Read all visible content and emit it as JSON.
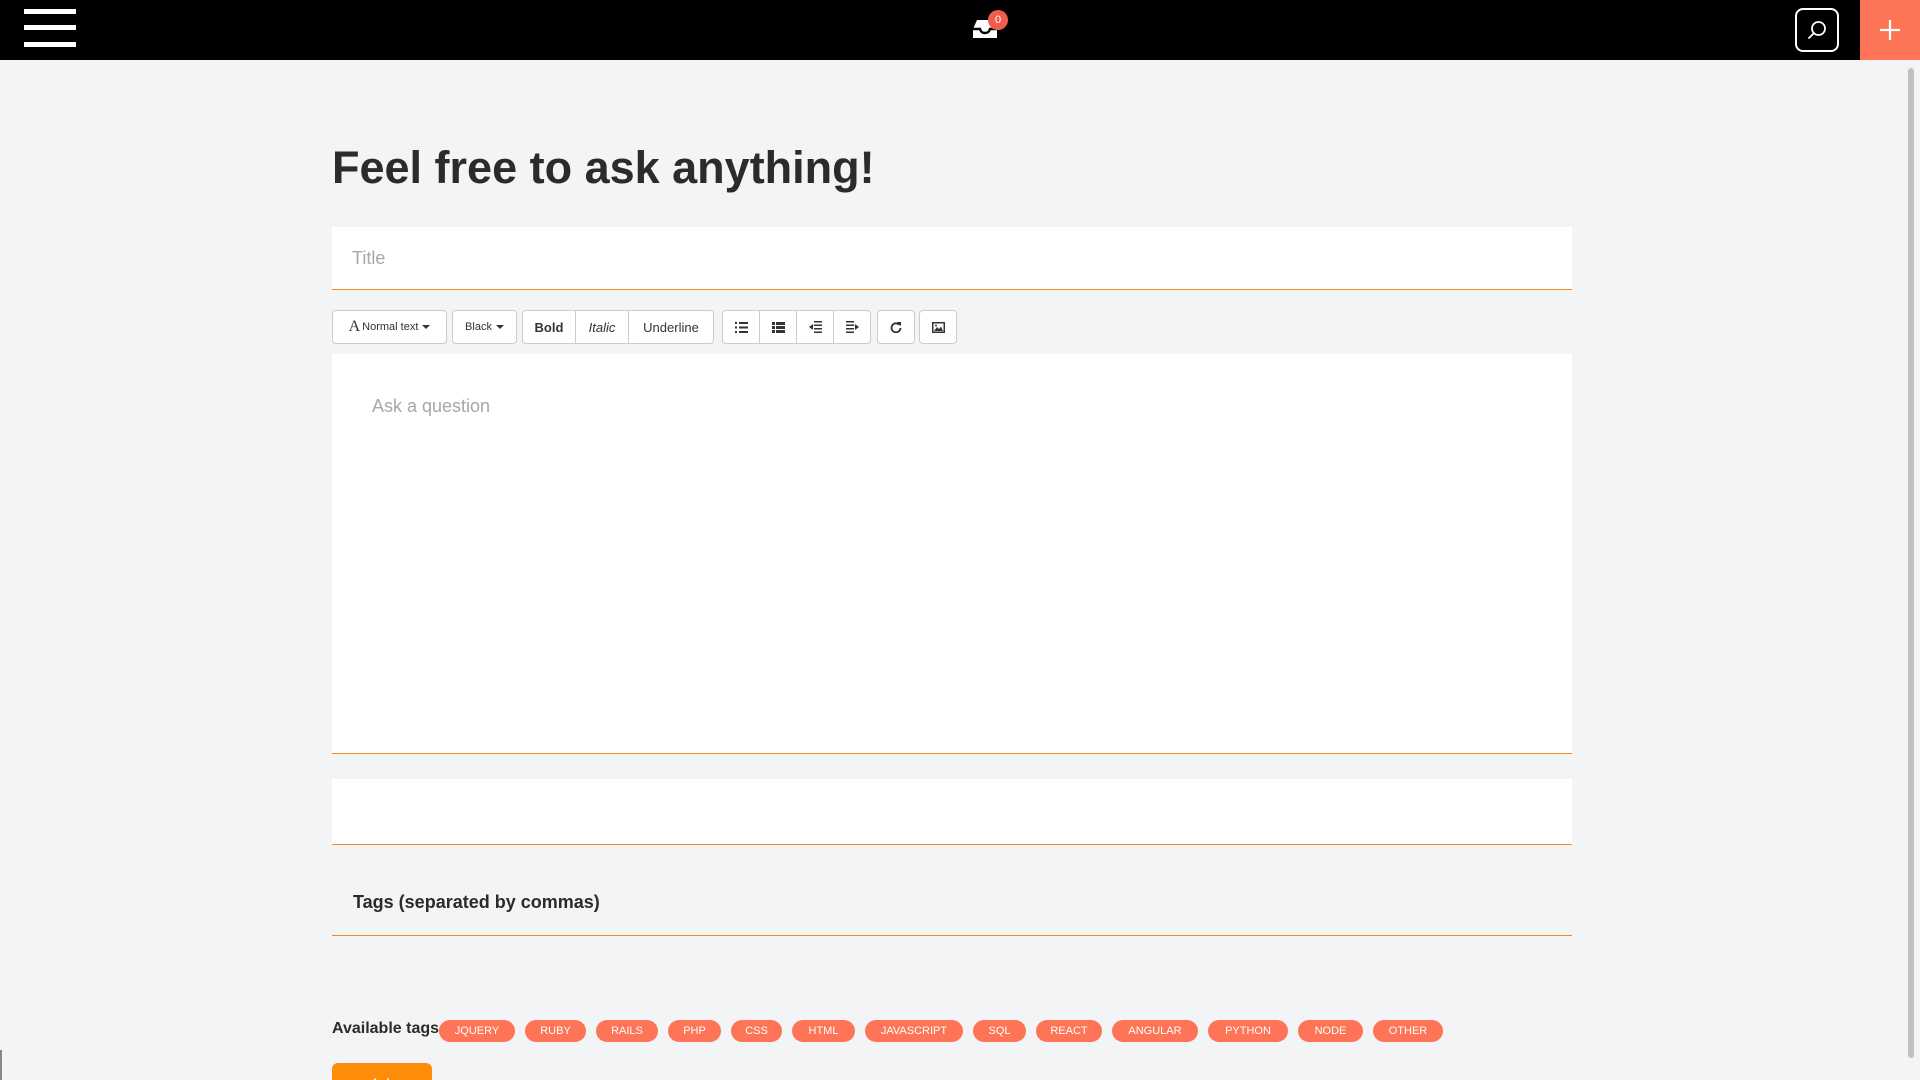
{
  "topbar": {
    "menu_icon": "hamburger-menu-icon",
    "inbox_icon": "inbox-icon",
    "inbox_count": "0",
    "search_icon": "search-icon",
    "plus_icon": "plus-icon",
    "background": "#000000",
    "accent": "#fe7456"
  },
  "page": {
    "heading": "Feel free to ask anything!"
  },
  "form": {
    "title_placeholder": "Title",
    "toolbar": {
      "text_style": "Normal text",
      "color": "Black",
      "bold": "Bold",
      "italic": "Italic",
      "underline": "Underline",
      "icons": [
        "bulleted-list-icon",
        "numbered-list-icon",
        "outdent-icon",
        "indent-icon",
        "redo-icon",
        "image-icon"
      ]
    },
    "editor_placeholder": "Ask a question",
    "tags_label": "Tags (separated by commas)",
    "available_tags_label": "Available tags:",
    "available_tags": [
      "JQUERY",
      "RUBY",
      "RAILS",
      "PHP",
      "CSS",
      "HTML",
      "JAVASCRIPT",
      "SQL",
      "REACT",
      "ANGULAR",
      "PYTHON",
      "NODE",
      "OTHER"
    ],
    "submit_label": "Ask",
    "underline_color": "#f08a24",
    "submit_color": "#fd8d09"
  }
}
